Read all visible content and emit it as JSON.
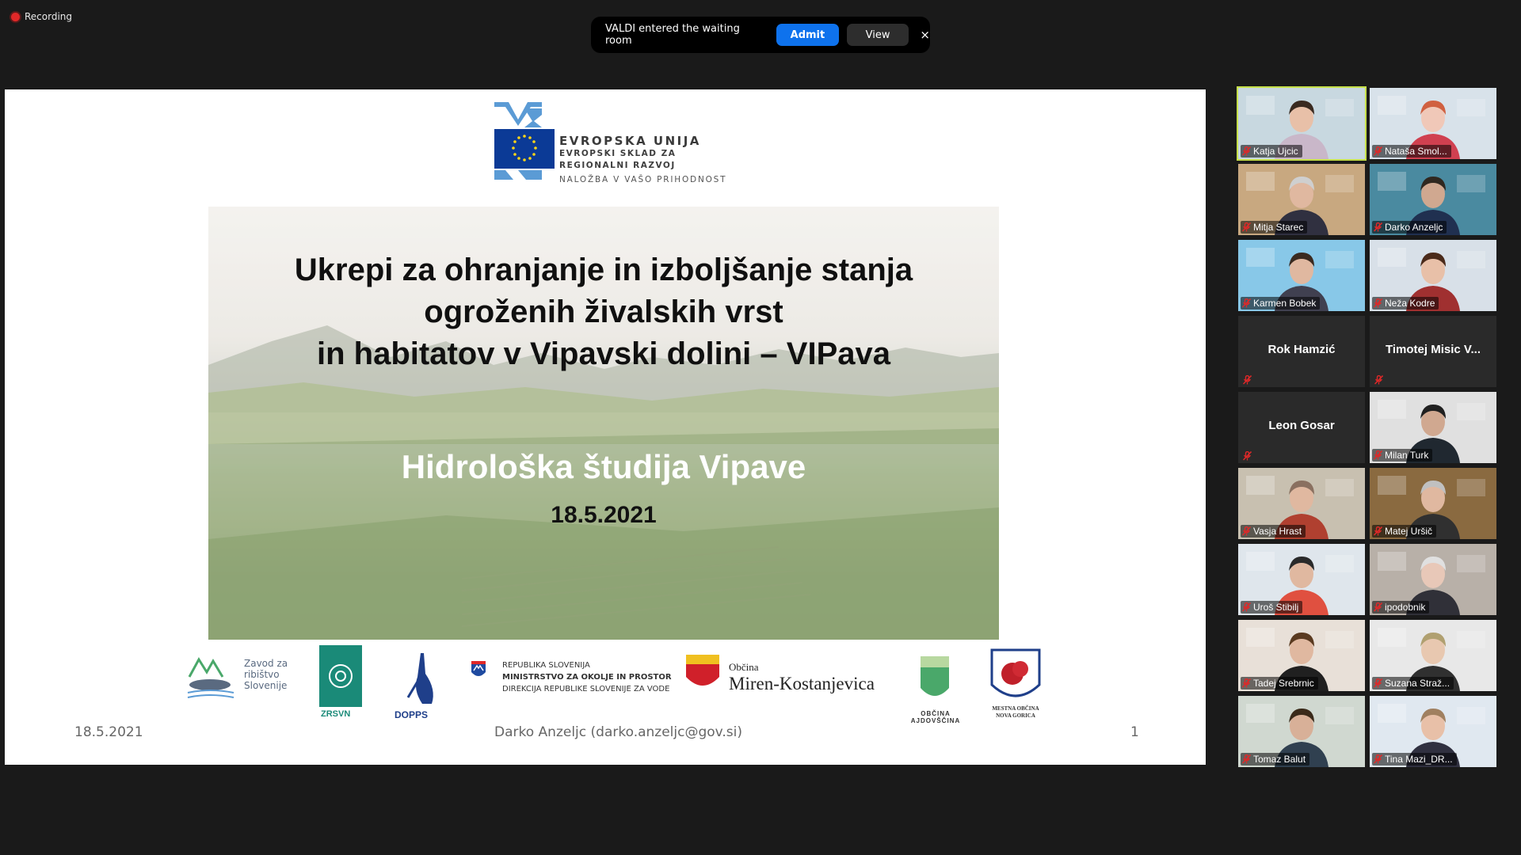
{
  "recording": {
    "label": "Recording"
  },
  "notification": {
    "text": "VALDI entered the waiting room",
    "admit": "Admit",
    "view": "View",
    "close": "×"
  },
  "slide": {
    "eu": {
      "title": "EVROPSKA UNIJA",
      "line1": "EVROPSKI SKLAD ZA",
      "line2": "REGIONALNI RAZVOJ",
      "tagline": "NALOŽBA V VAŠO PRIHODNOST"
    },
    "title_lines": [
      "Ukrepi za ohranjanje in izboljšanje stanja",
      "ogroženih živalskih vrst",
      "in habitatov v Vipavski dolini – VIPava"
    ],
    "subtitle": "Hidrološka študija Vipave",
    "date": "18.5.2021",
    "logos": {
      "zrsvn": "ZRSVN",
      "dopps": "DOPPS",
      "zavod": [
        "Zavod za",
        "ribištvo",
        "Slovenije"
      ],
      "republika": [
        "REPUBLIKA SLOVENIJA",
        "MINISTRSTVO ZA OKOLJE IN PROSTOR",
        "DIREKCIJA REPUBLIKE SLOVENIJE ZA VODE"
      ],
      "miren": [
        "Občina",
        "Miren-Kostanjevica"
      ],
      "ajdovscina": "OBČINA AJDOVŠČINA",
      "gorica": [
        "MESTNA OBČINA",
        "NOVA GORICA"
      ]
    },
    "footer": {
      "date": "18.5.2021",
      "author": "Darko Anzeljc (darko.anzeljc@gov.si)",
      "page": "1"
    }
  },
  "participants": [
    {
      "name": "Katja Ujcic",
      "video": true,
      "active": true,
      "bg": "#c8d8e0",
      "skin": "#e8c0a8",
      "hair": "#3a2a20",
      "shirt": "#c9b7c9"
    },
    {
      "name": "Nataša Smol...",
      "video": true,
      "bg": "#d8e2ea",
      "skin": "#f0c8b8",
      "hair": "#d06040",
      "shirt": "#d04050"
    },
    {
      "name": "Mitja Starec",
      "video": true,
      "bg": "#c8a880",
      "skin": "#e0b8a0",
      "hair": "#cfcfcf",
      "shirt": "#303040"
    },
    {
      "name": "Darko Anzeljc",
      "video": true,
      "bg": "#4a8aa0",
      "skin": "#d0a890",
      "hair": "#302820",
      "shirt": "#203050"
    },
    {
      "name": "Karmen Bobek",
      "video": true,
      "bg": "#88c8e8",
      "skin": "#e0b8a0",
      "hair": "#3a2a20",
      "shirt": "#404050"
    },
    {
      "name": "Neža Kodre",
      "video": true,
      "bg": "#d8e0e8",
      "skin": "#e8c0a8",
      "hair": "#4a2a1a",
      "shirt": "#a03030"
    },
    {
      "name": "Rok Hamzić",
      "video": false
    },
    {
      "name": "Timotej Misic V...",
      "video": false
    },
    {
      "name": "Leon Gosar",
      "video": false
    },
    {
      "name": "Milan Turk",
      "video": true,
      "bg": "#e0e0e0",
      "skin": "#d0a890",
      "hair": "#202020",
      "shirt": "#202830"
    },
    {
      "name": "Vasja Hrast",
      "video": true,
      "bg": "#c8c0b0",
      "skin": "#e0b8a0",
      "hair": "#8a7060",
      "shirt": "#b04030"
    },
    {
      "name": "Matej Uršič",
      "video": true,
      "bg": "#8a6a40",
      "skin": "#e0b8a0",
      "hair": "#c0c0c0",
      "shirt": "#303030"
    },
    {
      "name": "Uroš Stibilj",
      "video": true,
      "bg": "#dfe6ec",
      "skin": "#e0b8a0",
      "hair": "#2a2a2a",
      "shirt": "#e05040"
    },
    {
      "name": "ipodobnik",
      "video": true,
      "bg": "#b8b0a8",
      "skin": "#e8c8b8",
      "hair": "#e0e0e0",
      "shirt": "#303038"
    },
    {
      "name": "Tadej Srebrnic",
      "video": true,
      "bg": "#e8e0d8",
      "skin": "#e0b8a0",
      "hair": "#5a3a20",
      "shirt": "#202020"
    },
    {
      "name": "Suzana Straž...",
      "video": true,
      "bg": "#e8e8e8",
      "skin": "#e8c8b0",
      "hair": "#b0a070",
      "shirt": "#303030"
    },
    {
      "name": "Tomaz Balut",
      "video": true,
      "bg": "#d0d8d0",
      "skin": "#d8b098",
      "hair": "#3a2a1a",
      "shirt": "#304050"
    },
    {
      "name": "Tina Mazi_DR...",
      "video": true,
      "bg": "#e0e8f0",
      "skin": "#e8c0a8",
      "hair": "#a08060",
      "shirt": "#303040"
    }
  ],
  "colors": {
    "accent": "#0e72ed",
    "active_border": "#c6e04a",
    "mute": "#e02828",
    "eu_blue": "#0b3a96",
    "eu_light": "#5b9bd5"
  }
}
